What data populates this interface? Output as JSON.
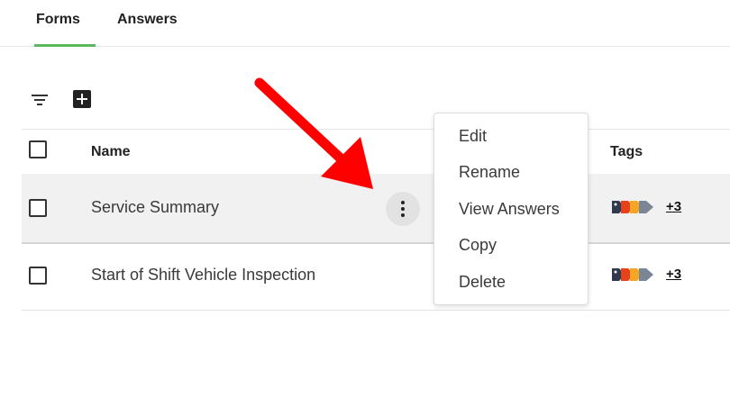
{
  "tabs": [
    {
      "label": "Forms",
      "active": true
    },
    {
      "label": "Answers",
      "active": false
    }
  ],
  "toolbar": {
    "filter_icon": "filter-icon",
    "add_icon": "add-box-icon"
  },
  "table": {
    "columns": {
      "name": "Name",
      "tags": "Tags"
    },
    "rows": [
      {
        "name": "Service Summary",
        "tags_more": "+3",
        "highlighted": true
      },
      {
        "name": "Start of Shift Vehicle Inspection",
        "tags_more": "+3",
        "highlighted": false
      }
    ],
    "tag_colors": [
      "#2f3a4f",
      "#e8421c",
      "#f5a623",
      "#7a8696"
    ]
  },
  "context_menu": {
    "items": [
      "Edit",
      "Rename",
      "View Answers",
      "Copy",
      "Delete"
    ]
  },
  "colors": {
    "accent_underline": "#5cb85c",
    "annotation_arrow": "#ff0000"
  }
}
